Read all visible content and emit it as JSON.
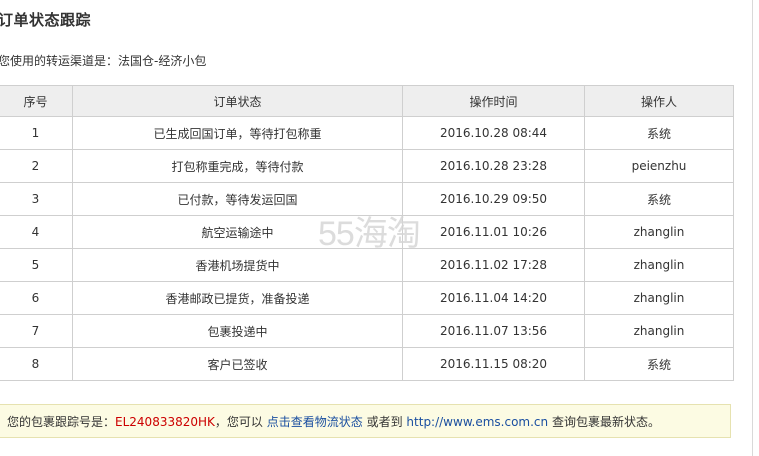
{
  "title": "订单状态跟踪",
  "channel": {
    "label": "您使用的转运渠道是：",
    "value": "法国仓-经济小包"
  },
  "table": {
    "headers": [
      "序号",
      "订单状态",
      "操作时间",
      "操作人"
    ],
    "rows": [
      {
        "no": "1",
        "status": "已生成回国订单，等待打包称重",
        "time": "2016.10.28 08:44",
        "operator": "系统"
      },
      {
        "no": "2",
        "status": "打包称重完成，等待付款",
        "time": "2016.10.28 23:28",
        "operator": "peienzhu"
      },
      {
        "no": "3",
        "status": "已付款，等待发运回国",
        "time": "2016.10.29 09:50",
        "operator": "系统"
      },
      {
        "no": "4",
        "status": "航空运输途中",
        "time": "2016.11.01 10:26",
        "operator": "zhanglin"
      },
      {
        "no": "5",
        "status": "香港机场提货中",
        "time": "2016.11.02 17:28",
        "operator": "zhanglin"
      },
      {
        "no": "6",
        "status": "香港邮政已提货，准备投递",
        "time": "2016.11.04 14:20",
        "operator": "zhanglin"
      },
      {
        "no": "7",
        "status": "包裹投递中",
        "time": "2016.11.07 13:56",
        "operator": "zhanglin"
      },
      {
        "no": "8",
        "status": "客户已签收",
        "time": "2016.11.15 08:20",
        "operator": "系统"
      }
    ]
  },
  "watermark": "55海淘",
  "notice": {
    "prefix": "您的包裹跟踪号是：",
    "tracking_number": "EL240833820HK",
    "middle": "，您可以",
    "link_text": "点击查看物流状态",
    "or_text": "或者到",
    "url_text": "http://www.ems.com.cn",
    "suffix": "查询包裹最新状态。"
  }
}
